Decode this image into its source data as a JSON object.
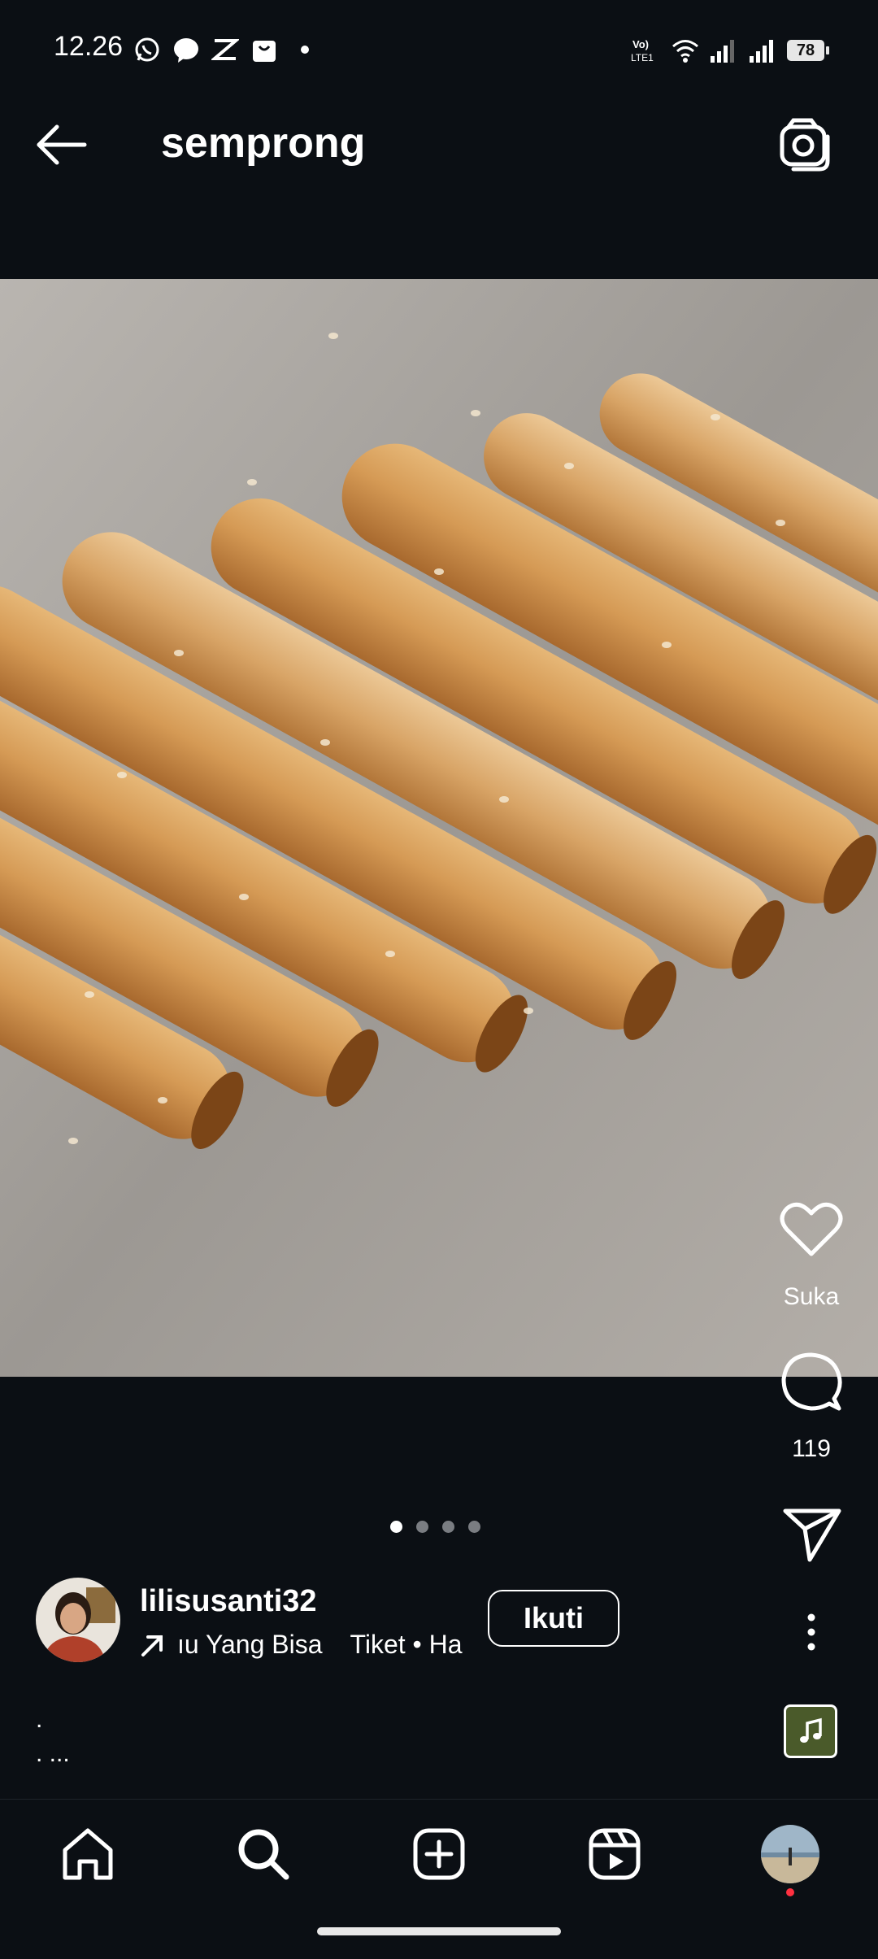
{
  "status_bar": {
    "time": "12.26",
    "battery": "78",
    "network": "LTE1"
  },
  "header": {
    "title": "semprong"
  },
  "actions": {
    "like_label": "Suka",
    "comment_count": "119"
  },
  "carousel": {
    "total": 4,
    "active_index": 0
  },
  "author": {
    "username": "lilisusanti32",
    "music_text": "ıu Yang Bisa",
    "music_text_2": "Tiket • Ha",
    "follow_label": "Ikuti"
  },
  "caption": {
    "line1": ".",
    "line2": ". ..."
  },
  "colors": {
    "background": "#0b0f14",
    "text": "#ffffff",
    "inactive_dot": "#7a7d82",
    "notification_dot": "#ff3040"
  },
  "icons": [
    "back-arrow-icon",
    "camera-icon",
    "heart-icon",
    "comment-icon",
    "send-icon",
    "more-icon",
    "music-icon",
    "home-icon",
    "search-icon",
    "create-icon",
    "reels-icon",
    "profile-icon"
  ]
}
